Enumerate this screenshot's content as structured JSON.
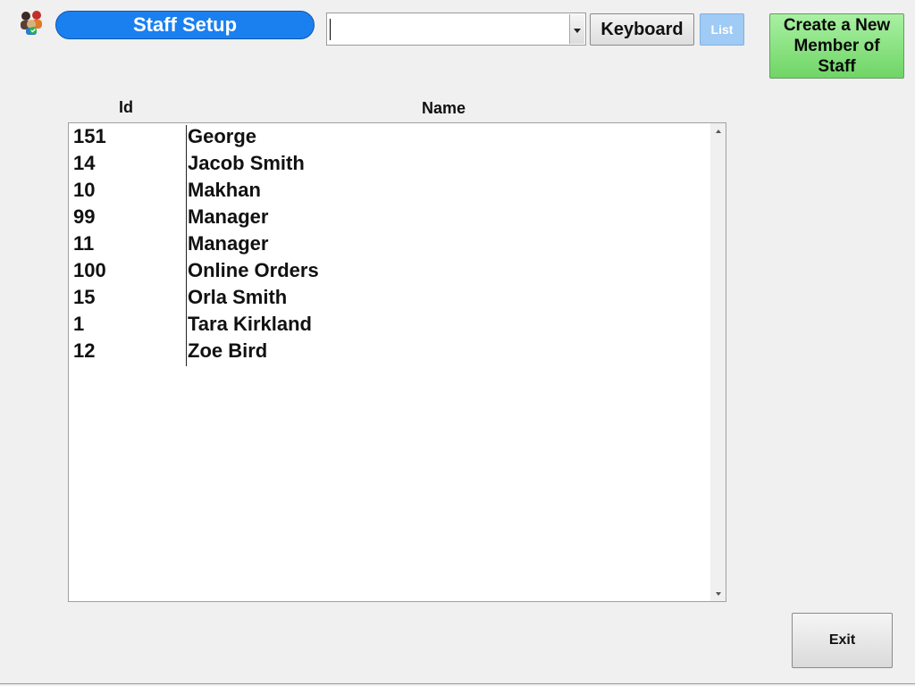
{
  "header": {
    "title": "Staff Setup",
    "search": {
      "value": ""
    },
    "keyboard_label": "Keyboard",
    "list_label": "List",
    "create_label": "Create a New Member of Staff"
  },
  "table": {
    "columns": {
      "id": "Id",
      "name": "Name"
    },
    "rows": [
      {
        "id": "151",
        "name": "George"
      },
      {
        "id": "14",
        "name": "Jacob Smith"
      },
      {
        "id": "10",
        "name": "Makhan"
      },
      {
        "id": "99",
        "name": "Manager"
      },
      {
        "id": "11",
        "name": "Manager"
      },
      {
        "id": "100",
        "name": "Online Orders"
      },
      {
        "id": "15",
        "name": "Orla Smith"
      },
      {
        "id": "1",
        "name": "Tara Kirkland"
      },
      {
        "id": "12",
        "name": "Zoe Bird"
      }
    ]
  },
  "footer": {
    "exit_label": "Exit"
  },
  "icons": {
    "app": "staff-group-icon",
    "combo": "chevron-down-icon",
    "scroll_up": "scroll-up-arrow-icon",
    "scroll_down": "scroll-down-arrow-icon"
  },
  "colors": {
    "title_pill": "#1a80f0",
    "list_button": "#9fcbf4",
    "create_button": "#6fd565",
    "background": "#f0f0f0"
  }
}
